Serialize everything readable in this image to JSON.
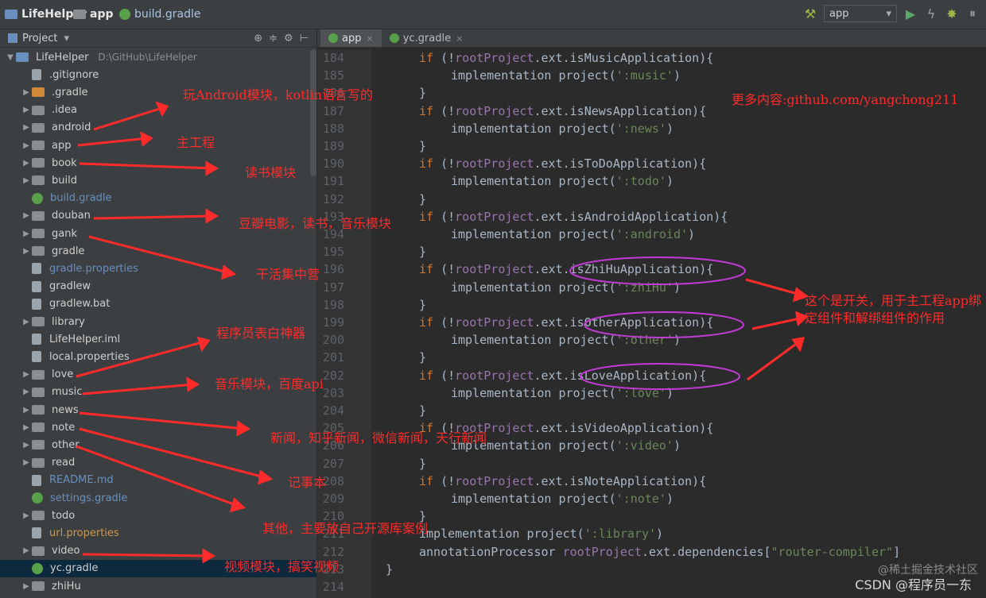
{
  "top": {
    "project": "LifeHelper",
    "module": "app",
    "file": "build.gradle",
    "run_config": "app"
  },
  "left_panel": {
    "header": "Project",
    "tree": [
      {
        "name": "LifeHelper",
        "path": "D:\\GitHub\\LifeHelper",
        "indent": 1,
        "arrow": "▼",
        "type": "folder-blue"
      },
      {
        "name": ".gitignore",
        "indent": 2,
        "arrow": "",
        "type": "file"
      },
      {
        "name": ".gradle",
        "indent": 2,
        "arrow": "▶",
        "type": "folder-orange"
      },
      {
        "name": ".idea",
        "indent": 2,
        "arrow": "▶",
        "type": "folder"
      },
      {
        "name": "android",
        "indent": 2,
        "arrow": "▶",
        "type": "folder"
      },
      {
        "name": "app",
        "indent": 2,
        "arrow": "▶",
        "type": "folder"
      },
      {
        "name": "book",
        "indent": 2,
        "arrow": "▶",
        "type": "folder"
      },
      {
        "name": "build",
        "indent": 2,
        "arrow": "▶",
        "type": "folder"
      },
      {
        "name": "build.gradle",
        "indent": 2,
        "arrow": "",
        "type": "gradle",
        "color": "blue"
      },
      {
        "name": "douban",
        "indent": 2,
        "arrow": "▶",
        "type": "folder"
      },
      {
        "name": "gank",
        "indent": 2,
        "arrow": "▶",
        "type": "folder"
      },
      {
        "name": "gradle",
        "indent": 2,
        "arrow": "▶",
        "type": "folder"
      },
      {
        "name": "gradle.properties",
        "indent": 2,
        "arrow": "",
        "type": "file",
        "color": "blue"
      },
      {
        "name": "gradlew",
        "indent": 2,
        "arrow": "",
        "type": "file"
      },
      {
        "name": "gradlew.bat",
        "indent": 2,
        "arrow": "",
        "type": "file"
      },
      {
        "name": "library",
        "indent": 2,
        "arrow": "▶",
        "type": "folder"
      },
      {
        "name": "LifeHelper.iml",
        "indent": 2,
        "arrow": "",
        "type": "file"
      },
      {
        "name": "local.properties",
        "indent": 2,
        "arrow": "",
        "type": "file"
      },
      {
        "name": "love",
        "indent": 2,
        "arrow": "▶",
        "type": "folder"
      },
      {
        "name": "music",
        "indent": 2,
        "arrow": "▶",
        "type": "folder"
      },
      {
        "name": "news",
        "indent": 2,
        "arrow": "▶",
        "type": "folder"
      },
      {
        "name": "note",
        "indent": 2,
        "arrow": "▶",
        "type": "folder"
      },
      {
        "name": "other",
        "indent": 2,
        "arrow": "▶",
        "type": "folder"
      },
      {
        "name": "read",
        "indent": 2,
        "arrow": "▶",
        "type": "folder"
      },
      {
        "name": "README.md",
        "indent": 2,
        "arrow": "",
        "type": "file",
        "color": "blue"
      },
      {
        "name": "settings.gradle",
        "indent": 2,
        "arrow": "",
        "type": "gradle",
        "color": "blue"
      },
      {
        "name": "todo",
        "indent": 2,
        "arrow": "▶",
        "type": "folder"
      },
      {
        "name": "url.properties",
        "indent": 2,
        "arrow": "",
        "type": "file",
        "color": "gold"
      },
      {
        "name": "video",
        "indent": 2,
        "arrow": "▶",
        "type": "folder"
      },
      {
        "name": "yc.gradle",
        "indent": 2,
        "arrow": "",
        "type": "gradle",
        "selected": true
      },
      {
        "name": "zhiHu",
        "indent": 2,
        "arrow": "▶",
        "type": "folder"
      }
    ]
  },
  "editor": {
    "tabs": [
      {
        "label": "app",
        "active": true
      },
      {
        "label": "yc.gradle",
        "active": false
      }
    ],
    "lines": [
      {
        "n": "184",
        "indent": 1,
        "tokens": [
          [
            "kw",
            "if "
          ],
          [
            "t",
            "(!"
          ],
          [
            "vr",
            "rootProject"
          ],
          [
            "t",
            ".ext.isMusicApplication){"
          ]
        ]
      },
      {
        "n": "185",
        "indent": 2,
        "tokens": [
          [
            "t",
            "implementation project("
          ],
          [
            "st",
            "':music'"
          ],
          [
            "t",
            ")"
          ]
        ]
      },
      {
        "n": "186",
        "indent": 1,
        "tokens": [
          [
            "t",
            "}"
          ]
        ]
      },
      {
        "n": "187",
        "indent": 1,
        "tokens": [
          [
            "kw",
            "if "
          ],
          [
            "t",
            "(!"
          ],
          [
            "vr",
            "rootProject"
          ],
          [
            "t",
            ".ext.isNewsApplication){"
          ]
        ]
      },
      {
        "n": "188",
        "indent": 2,
        "tokens": [
          [
            "t",
            "implementation project("
          ],
          [
            "st",
            "':news'"
          ],
          [
            "t",
            ")"
          ]
        ]
      },
      {
        "n": "189",
        "indent": 1,
        "tokens": [
          [
            "t",
            "}"
          ]
        ]
      },
      {
        "n": "190",
        "indent": 1,
        "tokens": [
          [
            "kw",
            "if "
          ],
          [
            "t",
            "(!"
          ],
          [
            "vr",
            "rootProject"
          ],
          [
            "t",
            ".ext.isToDoApplication){"
          ]
        ]
      },
      {
        "n": "191",
        "indent": 2,
        "tokens": [
          [
            "t",
            "implementation project("
          ],
          [
            "st",
            "':todo'"
          ],
          [
            "t",
            ")"
          ]
        ]
      },
      {
        "n": "192",
        "indent": 1,
        "tokens": [
          [
            "t",
            "}"
          ]
        ]
      },
      {
        "n": "193",
        "indent": 1,
        "tokens": [
          [
            "kw",
            "if "
          ],
          [
            "t",
            "(!"
          ],
          [
            "vr",
            "rootProject"
          ],
          [
            "t",
            ".ext.isAndroidApplication){"
          ]
        ]
      },
      {
        "n": "194",
        "indent": 2,
        "tokens": [
          [
            "t",
            "implementation project("
          ],
          [
            "st",
            "':android'"
          ],
          [
            "t",
            ")"
          ]
        ]
      },
      {
        "n": "195",
        "indent": 1,
        "tokens": [
          [
            "t",
            "}"
          ]
        ]
      },
      {
        "n": "196",
        "indent": 1,
        "tokens": [
          [
            "kw",
            "if "
          ],
          [
            "t",
            "(!"
          ],
          [
            "vr",
            "rootProject"
          ],
          [
            "t",
            ".ext.isZhiHuApplication){"
          ]
        ]
      },
      {
        "n": "197",
        "indent": 2,
        "tokens": [
          [
            "t",
            "implementation project("
          ],
          [
            "st",
            "':zhiHu'"
          ],
          [
            "t",
            ")"
          ]
        ]
      },
      {
        "n": "198",
        "indent": 1,
        "tokens": [
          [
            "t",
            "}"
          ]
        ]
      },
      {
        "n": "199",
        "indent": 1,
        "tokens": [
          [
            "kw",
            "if "
          ],
          [
            "t",
            "(!"
          ],
          [
            "vr",
            "rootProject"
          ],
          [
            "t",
            ".ext.isOtherApplication){"
          ]
        ]
      },
      {
        "n": "200",
        "indent": 2,
        "tokens": [
          [
            "t",
            "implementation project("
          ],
          [
            "st",
            "':other'"
          ],
          [
            "t",
            ")"
          ]
        ]
      },
      {
        "n": "201",
        "indent": 1,
        "tokens": [
          [
            "t",
            "}"
          ]
        ]
      },
      {
        "n": "202",
        "indent": 1,
        "tokens": [
          [
            "kw",
            "if "
          ],
          [
            "t",
            "(!"
          ],
          [
            "vr",
            "rootProject"
          ],
          [
            "t",
            ".ext.isLoveApplication){"
          ]
        ]
      },
      {
        "n": "203",
        "indent": 2,
        "tokens": [
          [
            "t",
            "implementation project("
          ],
          [
            "st",
            "':love'"
          ],
          [
            "t",
            ")"
          ]
        ]
      },
      {
        "n": "204",
        "indent": 1,
        "tokens": [
          [
            "t",
            "}"
          ]
        ]
      },
      {
        "n": "205",
        "indent": 1,
        "tokens": [
          [
            "kw",
            "if "
          ],
          [
            "t",
            "(!"
          ],
          [
            "vr",
            "rootProject"
          ],
          [
            "t",
            ".ext.isVideoApplication){"
          ]
        ]
      },
      {
        "n": "206",
        "indent": 2,
        "tokens": [
          [
            "t",
            "implementation project("
          ],
          [
            "st",
            "':video'"
          ],
          [
            "t",
            ")"
          ]
        ]
      },
      {
        "n": "207",
        "indent": 1,
        "tokens": [
          [
            "t",
            "}"
          ]
        ]
      },
      {
        "n": "208",
        "indent": 1,
        "tokens": [
          [
            "kw",
            "if "
          ],
          [
            "t",
            "(!"
          ],
          [
            "vr",
            "rootProject"
          ],
          [
            "t",
            ".ext.isNoteApplication){"
          ]
        ]
      },
      {
        "n": "209",
        "indent": 2,
        "tokens": [
          [
            "t",
            "implementation project("
          ],
          [
            "st",
            "':note'"
          ],
          [
            "t",
            ")"
          ]
        ]
      },
      {
        "n": "210",
        "indent": 1,
        "tokens": [
          [
            "t",
            "}"
          ]
        ]
      },
      {
        "n": "211",
        "indent": 1,
        "tokens": [
          [
            "t",
            "implementation project("
          ],
          [
            "st",
            "':library'"
          ],
          [
            "t",
            ")"
          ]
        ]
      },
      {
        "n": "212",
        "indent": 1,
        "tokens": [
          [
            "t",
            "annotationProcessor "
          ],
          [
            "vr",
            "rootProject"
          ],
          [
            "t",
            ".ext.dependencies["
          ],
          [
            "st",
            "\"router-compiler\""
          ],
          [
            "t",
            "]"
          ]
        ]
      },
      {
        "n": "213",
        "indent": 0,
        "tokens": [
          [
            "t",
            "}"
          ]
        ]
      },
      {
        "n": "214",
        "indent": 0,
        "tokens": []
      }
    ]
  },
  "annotations": {
    "a1": "玩Android模块，kotlin语言写的",
    "a2": "主工程",
    "a3": "读书模块",
    "a4": "豆瓣电影，读书，音乐模块",
    "a5": "干活集中营",
    "a6": "程序员表白神器",
    "a7": "音乐模块，百度api",
    "a8": "新闻，知乎新闻，微信新闻，天行新闻",
    "a9": "记事本",
    "a10": "其他，主要放自己开源库案例",
    "a11": "视频模块，搞笑视频",
    "a12": "更多内容:github.com/yangchong211",
    "a13": "这个是开关，用于主工程app绑定组件和解绑组件的作用"
  },
  "watermark": {
    "line1": "@稀土掘金技术社区",
    "line2": "CSDN @程序员一东"
  },
  "colors": {
    "annotation": "#ff2b2b",
    "circle": "#c23bd6"
  }
}
